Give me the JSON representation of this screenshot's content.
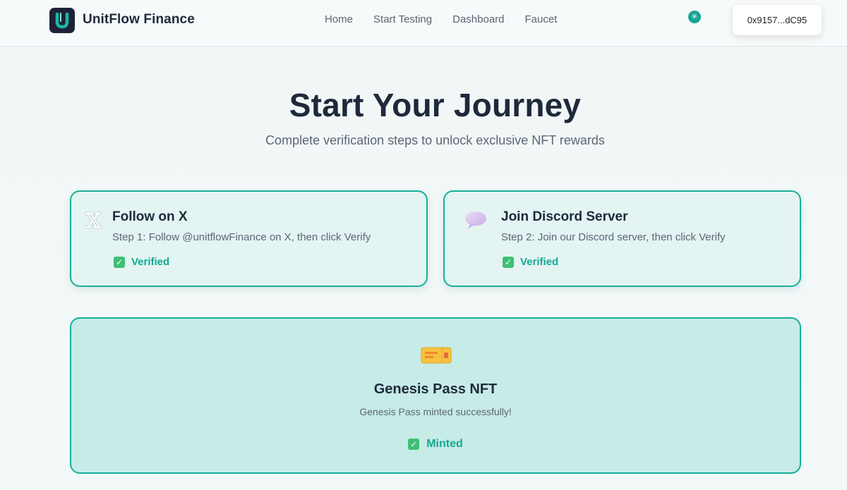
{
  "header": {
    "brand": "UnitFlow Finance",
    "logo_icon": "unitflow-logo-icon",
    "nav": [
      "Home",
      "Start Testing",
      "Dashboard",
      "Faucet"
    ],
    "status_icon": "network-status-icon",
    "wallet_address": "0x9157...dC95"
  },
  "hero": {
    "title": "Start Your Journey",
    "subtitle": "Complete verification steps to unlock exclusive NFT rewards"
  },
  "steps": [
    {
      "icon": "x-logo-icon",
      "icon_glyph": "𝕏",
      "title": "Follow on X",
      "description": "Step 1: Follow @unitflowFinance on X, then click Verify",
      "status": "Verified"
    },
    {
      "icon": "speech-bubble-icon",
      "title": "Join Discord Server",
      "description": "Step 2: Join our Discord server, then click Verify",
      "status": "Verified"
    }
  ],
  "nft": {
    "icon": "ticket-icon",
    "title": "Genesis Pass NFT",
    "message": "Genesis Pass minted successfully!",
    "status": "Minted"
  },
  "colors": {
    "accent": "#17b09b",
    "status_text": "#14a892",
    "check_green": "#3fbf76",
    "card_bg": "#e3f4f2",
    "nft_bg": "#c7ebe6",
    "title": "#1e2a3b"
  }
}
